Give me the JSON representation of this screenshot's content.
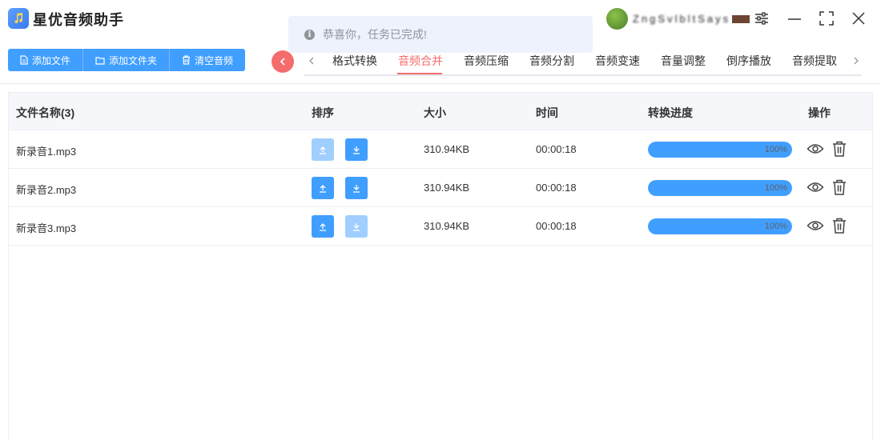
{
  "app": {
    "title": "星优音频助手"
  },
  "toast": {
    "text": "恭喜你，任务已完成!"
  },
  "user": {
    "name": "ZngSvlbltSays"
  },
  "toolbar": {
    "add_file": "添加文件",
    "add_folder": "添加文件夹",
    "clear_audio": "清空音频"
  },
  "tabs": [
    {
      "label": "格式转换"
    },
    {
      "label": "音频合并"
    },
    {
      "label": "音频压缩"
    },
    {
      "label": "音频分割"
    },
    {
      "label": "音频变速"
    },
    {
      "label": "音量调整"
    },
    {
      "label": "倒序播放"
    },
    {
      "label": "音频提取"
    }
  ],
  "active_tab": "音频合并",
  "colors": {
    "primary": "#409eff",
    "primary_disabled": "#a0cfff",
    "accent": "#f56c6c"
  },
  "table": {
    "headers": {
      "name": "文件名称(3)",
      "sort": "排序",
      "size": "大小",
      "time": "时间",
      "progress": "转换进度",
      "action": "操作"
    },
    "rows": [
      {
        "name": "新录音1.mp3",
        "size": "310.94KB",
        "time": "00:00:18",
        "progress": 1.0,
        "progress_label": "100%",
        "up_enabled": false,
        "down_enabled": true
      },
      {
        "name": "新录音2.mp3",
        "size": "310.94KB",
        "time": "00:00:18",
        "progress": 1.0,
        "progress_label": "100%",
        "up_enabled": true,
        "down_enabled": true
      },
      {
        "name": "新录音3.mp3",
        "size": "310.94KB",
        "time": "00:00:18",
        "progress": 1.0,
        "progress_label": "100%",
        "up_enabled": true,
        "down_enabled": false
      }
    ]
  }
}
